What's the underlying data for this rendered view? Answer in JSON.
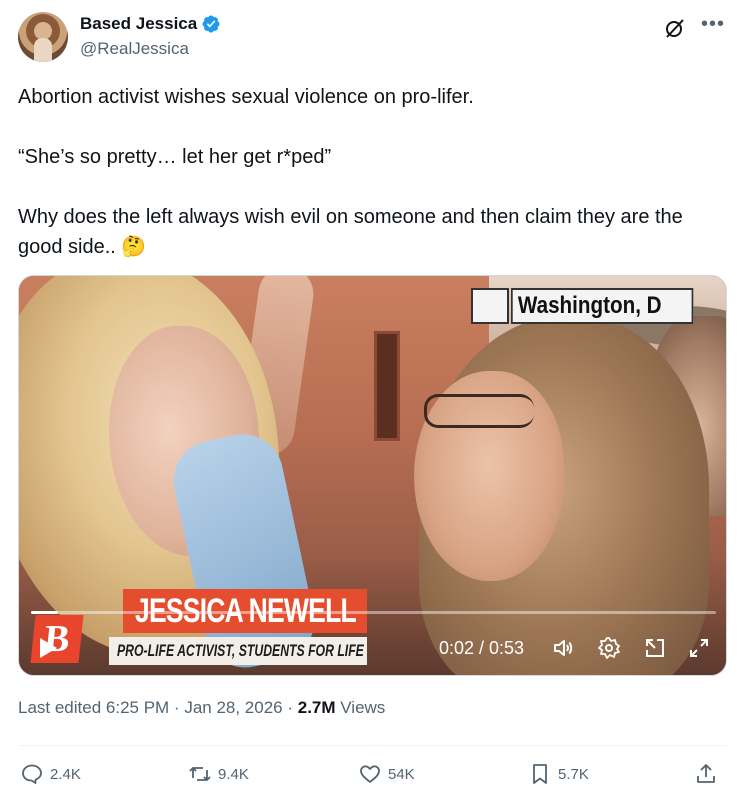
{
  "author": {
    "display_name": "Based Jessica",
    "handle": "@RealJessica",
    "verified": true
  },
  "tweet": {
    "paragraphs": [
      "Abortion activist wishes sexual violence on pro-lifer.",
      "“She’s so pretty… let her get r*ped”",
      "Why does the left always wish evil on someone and then claim they are the good side.. 🤔"
    ]
  },
  "media": {
    "location_label": "Washington, D",
    "chyron_name": "JESSICA NEWELL",
    "chyron_title": "PRO-LIFE ACTIVIST, STUDENTS FOR LIFE",
    "logo_letter": "B",
    "time_display": "0:02 / 0:53",
    "progress": 0.04
  },
  "meta": {
    "edited_prefix": "Last edited 6:25 PM · Jan 28, 2026 · ",
    "views_count": "2.7M",
    "views_label": " Views"
  },
  "actions": {
    "replies": "2.4K",
    "reposts": "9.4K",
    "likes": "54K",
    "bookmarks": "5.7K"
  },
  "colors": {
    "text_primary": "#0f1419",
    "text_secondary": "#536471",
    "verified_blue": "#1d9bf0",
    "chyron_red": "#e44e2f"
  },
  "icons": {
    "verified": "verified-badge-icon",
    "grok": "grok-icon",
    "more": "more-icon",
    "play": "play-icon",
    "volume": "volume-icon",
    "settings": "settings-icon",
    "popout": "popout-icon",
    "fullscreen": "fullscreen-icon",
    "reply": "reply-icon",
    "repost": "repost-icon",
    "like": "like-icon",
    "bookmark": "bookmark-icon",
    "share": "share-icon"
  }
}
